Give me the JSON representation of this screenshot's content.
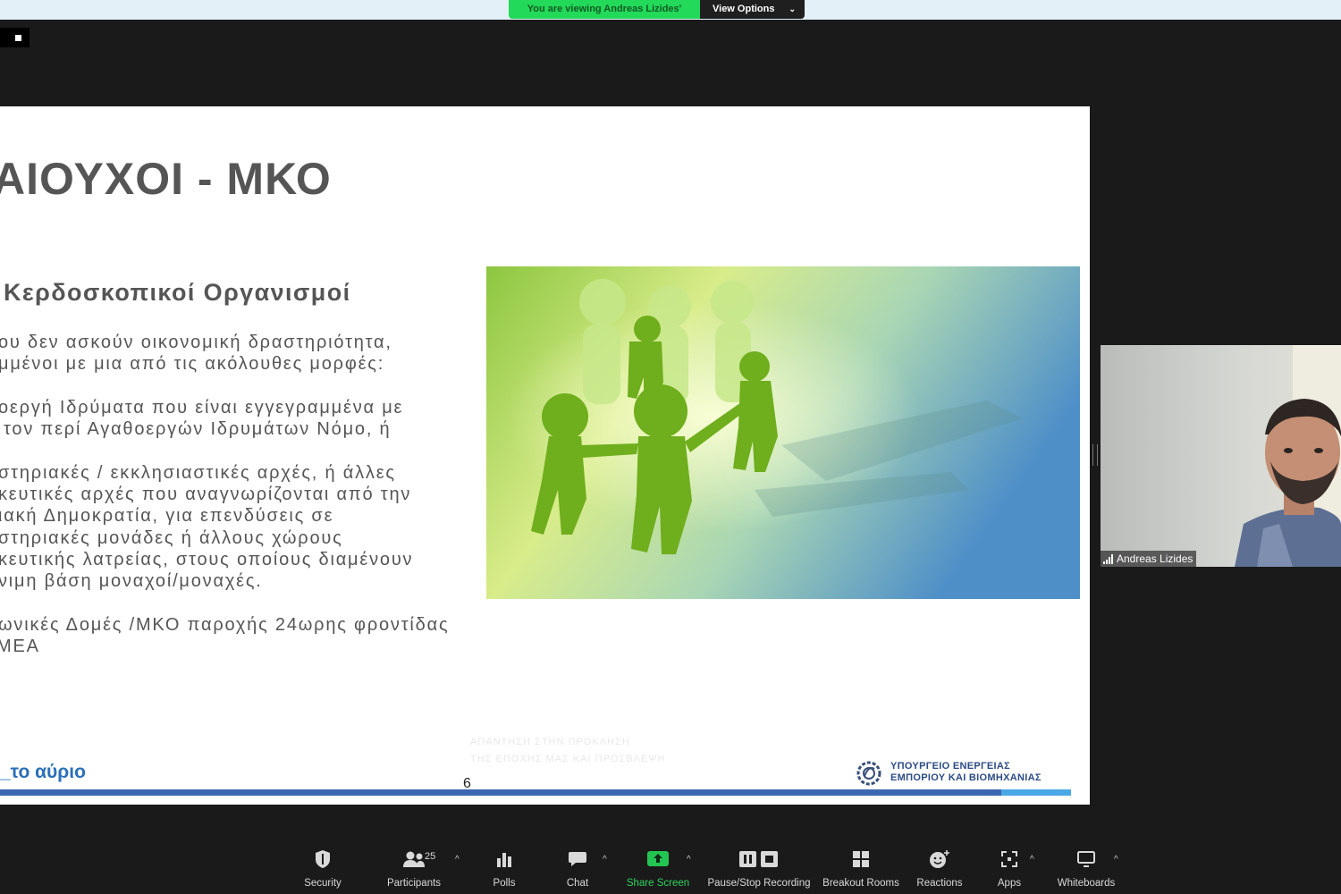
{
  "banner": {
    "viewing_text": "You are viewing Andreas Lizides' screen",
    "view_options_label": "View Options"
  },
  "slide": {
    "title": "ΑΙΟΥΧΟΙ - ΜΚΟ",
    "subtitle": "Κερδοσκοπικοί Οργανισμοί",
    "lines": [
      "ου δεν ασκούν οικονομική δραστηριότητα,",
      "μμένοι με μια από τις ακόλουθες μορφές:",
      "οεργή Ιδρύματα που είναι εγγεγραμμένα με",
      "τον περί Αγαθοεργών Ιδρυμάτων Νόμο, ή",
      "στηριακές / εκκλησιαστικές αρχές, ή άλλες",
      "κευτικές αρχές που αναγνωρίζονται από την",
      "ιακή Δημοκρατία, για επενδύσεις σε",
      "στηριακές μονάδες ή άλλους χώρους",
      "κευτικής λατρείας, στους οποίους διαμένουν",
      "νιμη βάση μοναχοί/μοναχές.",
      "ωνικές Δομές /ΜΚΟ παροχής 24ωρης φροντίδας",
      "ΜΕΑ"
    ],
    "footer_left": "_το αύριο",
    "page_number": "6",
    "ministry_line1": "ΥΠΟΥΡΓΕΙΟ ΕΝΕΡΓΕΙΑΣ",
    "ministry_line2": "ΕΜΠΟΡΙΟΥ ΚΑΙ ΒΙΟΜΗΧΑΝΙΑΣ",
    "faded_line1": "ΑΠΑΝΤΗΣΗ ΣΤΗΝ ΠΡΟΚΛΗΣΗ",
    "faded_line2": "ΤΗΣ ΕΠΟΧΗΣ ΜΑΣ ΚΑΙ ΠΡΟΣΒΛΕΨΗ"
  },
  "video": {
    "name": "Andreas Lizides"
  },
  "toolbar": {
    "security": "Security",
    "participants": "Participants",
    "participants_count": "25",
    "polls": "Polls",
    "chat": "Chat",
    "share_screen": "Share Screen",
    "recording": "Pause/Stop Recording",
    "breakout": "Breakout Rooms",
    "reactions": "Reactions",
    "apps": "Apps",
    "whiteboards": "Whiteboards",
    "share_color": "#2ed35c"
  }
}
